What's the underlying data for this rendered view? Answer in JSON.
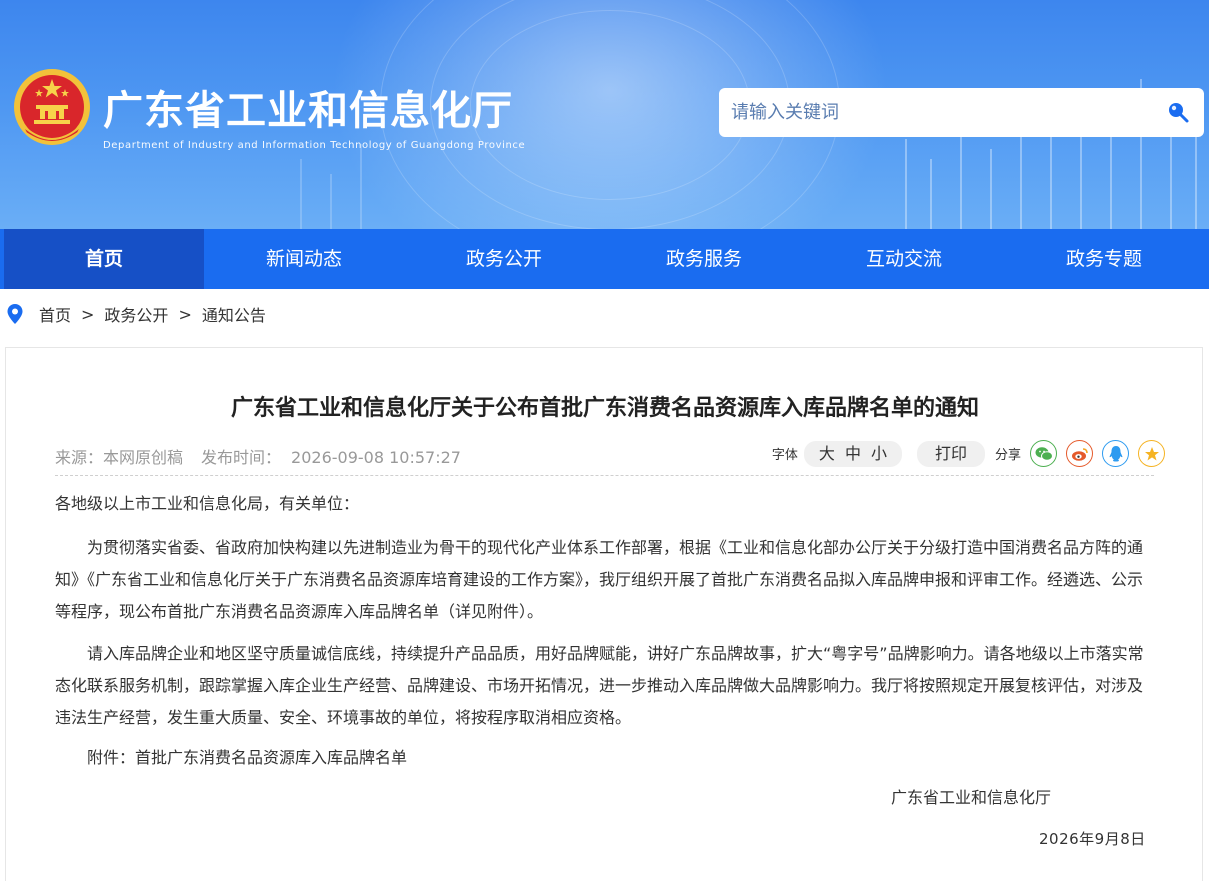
{
  "header": {
    "title": "广东省工业和信息化厅",
    "subtitle": "Department of Industry and Information Technology of Guangdong Province",
    "search_placeholder": "请输入关键词"
  },
  "nav": {
    "items": [
      "首页",
      "新闻动态",
      "政务公开",
      "政务服务",
      "互动交流",
      "政务专题"
    ],
    "active": "首页"
  },
  "breadcrumb": {
    "items": [
      "首页",
      "政务公开",
      "通知公告"
    ],
    "separator": ">"
  },
  "article": {
    "title": "广东省工业和信息化厅关于公布首批广东消费名品资源库入库品牌名单的通知",
    "source": "来源：本网原创稿",
    "publish_label": "发布时间：",
    "publish_time": "2026-09-08 10:57:27",
    "font_label": "字体",
    "font_sizes": [
      "大",
      "中",
      "小"
    ],
    "print_label": "打印",
    "share_label": "分享",
    "share_icons": [
      "wechat-icon",
      "weibo-icon",
      "qq-icon",
      "qzone-icon"
    ],
    "salutation": "各地级以上市工业和信息化局，有关单位：",
    "paragraphs": [
      "为贯彻落实省委、省政府加快构建以先进制造业为骨干的现代化产业体系工作部署，根据《工业和信息化部办公厅关于分级打造中国消费名品方阵的通知》《广东省工业和信息化厅关于广东消费名品资源库培育建设的工作方案》，我厅组织开展了首批广东消费名品拟入库品牌申报和评审工作。经遴选、公示等程序，现公布首批广东消费名品资源库入库品牌名单（详见附件）。",
      "请入库品牌企业和地区坚守质量诚信底线，持续提升产品品质，用好品牌赋能，讲好广东品牌故事，扩大“粤字号”品牌影响力。请各地级以上市落实常态化联系服务机制，跟踪掌握入库企业生产经营、品牌建设、市场开拓情况，进一步推动入库品牌做大品牌影响力。我厅将按照规定开展复核评估，对涉及违法生产经营，发生重大质量、安全、环境事故的单位，将按程序取消相应资格。",
      "附件：首批广东消费名品资源库入库品牌名单"
    ],
    "signature": "广东省工业和信息化厅",
    "date": "2026年9月8日"
  },
  "colors": {
    "nav_bg": "#1a6cf0",
    "nav_active": "#1650c6",
    "banner": "#4e97f2",
    "pin": "#1a6cf0"
  }
}
